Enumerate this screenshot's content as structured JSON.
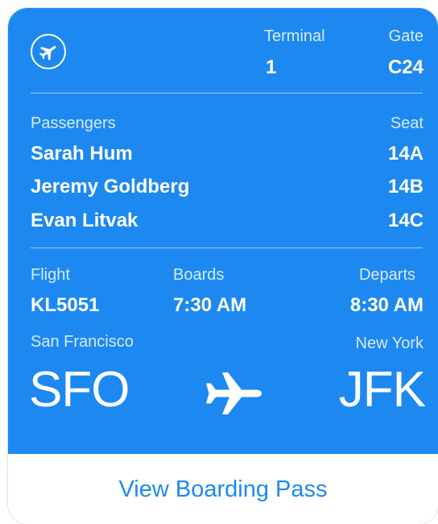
{
  "header": {
    "terminal_label": "Terminal",
    "terminal_value": "1",
    "gate_label": "Gate",
    "gate_value": "C24"
  },
  "passengers": {
    "label": "Passengers",
    "seat_label": "Seat",
    "list": [
      {
        "name": "Sarah Hum",
        "seat": "14A"
      },
      {
        "name": "Jeremy Goldberg",
        "seat": "14B"
      },
      {
        "name": "Evan Litvak",
        "seat": "14C"
      }
    ]
  },
  "flight": {
    "flight_label": "Flight",
    "flight_value": "KL5051",
    "boards_label": "Boards",
    "boards_value": "7:30 AM",
    "departs_label": "Departs",
    "departs_value": "8:30 AM"
  },
  "route": {
    "origin_city": "San Francisco",
    "origin_code": "SFO",
    "destination_city": "New York",
    "destination_code": "JFK"
  },
  "actions": {
    "view_boarding_pass": "View Boarding Pass"
  },
  "icons": {
    "header_icon": "airplane-circle-icon",
    "route_icon": "airplane-icon"
  },
  "colors": {
    "pass_background": "#1d89f0",
    "text": "#ffffff",
    "button_text": "#1d89f0"
  }
}
